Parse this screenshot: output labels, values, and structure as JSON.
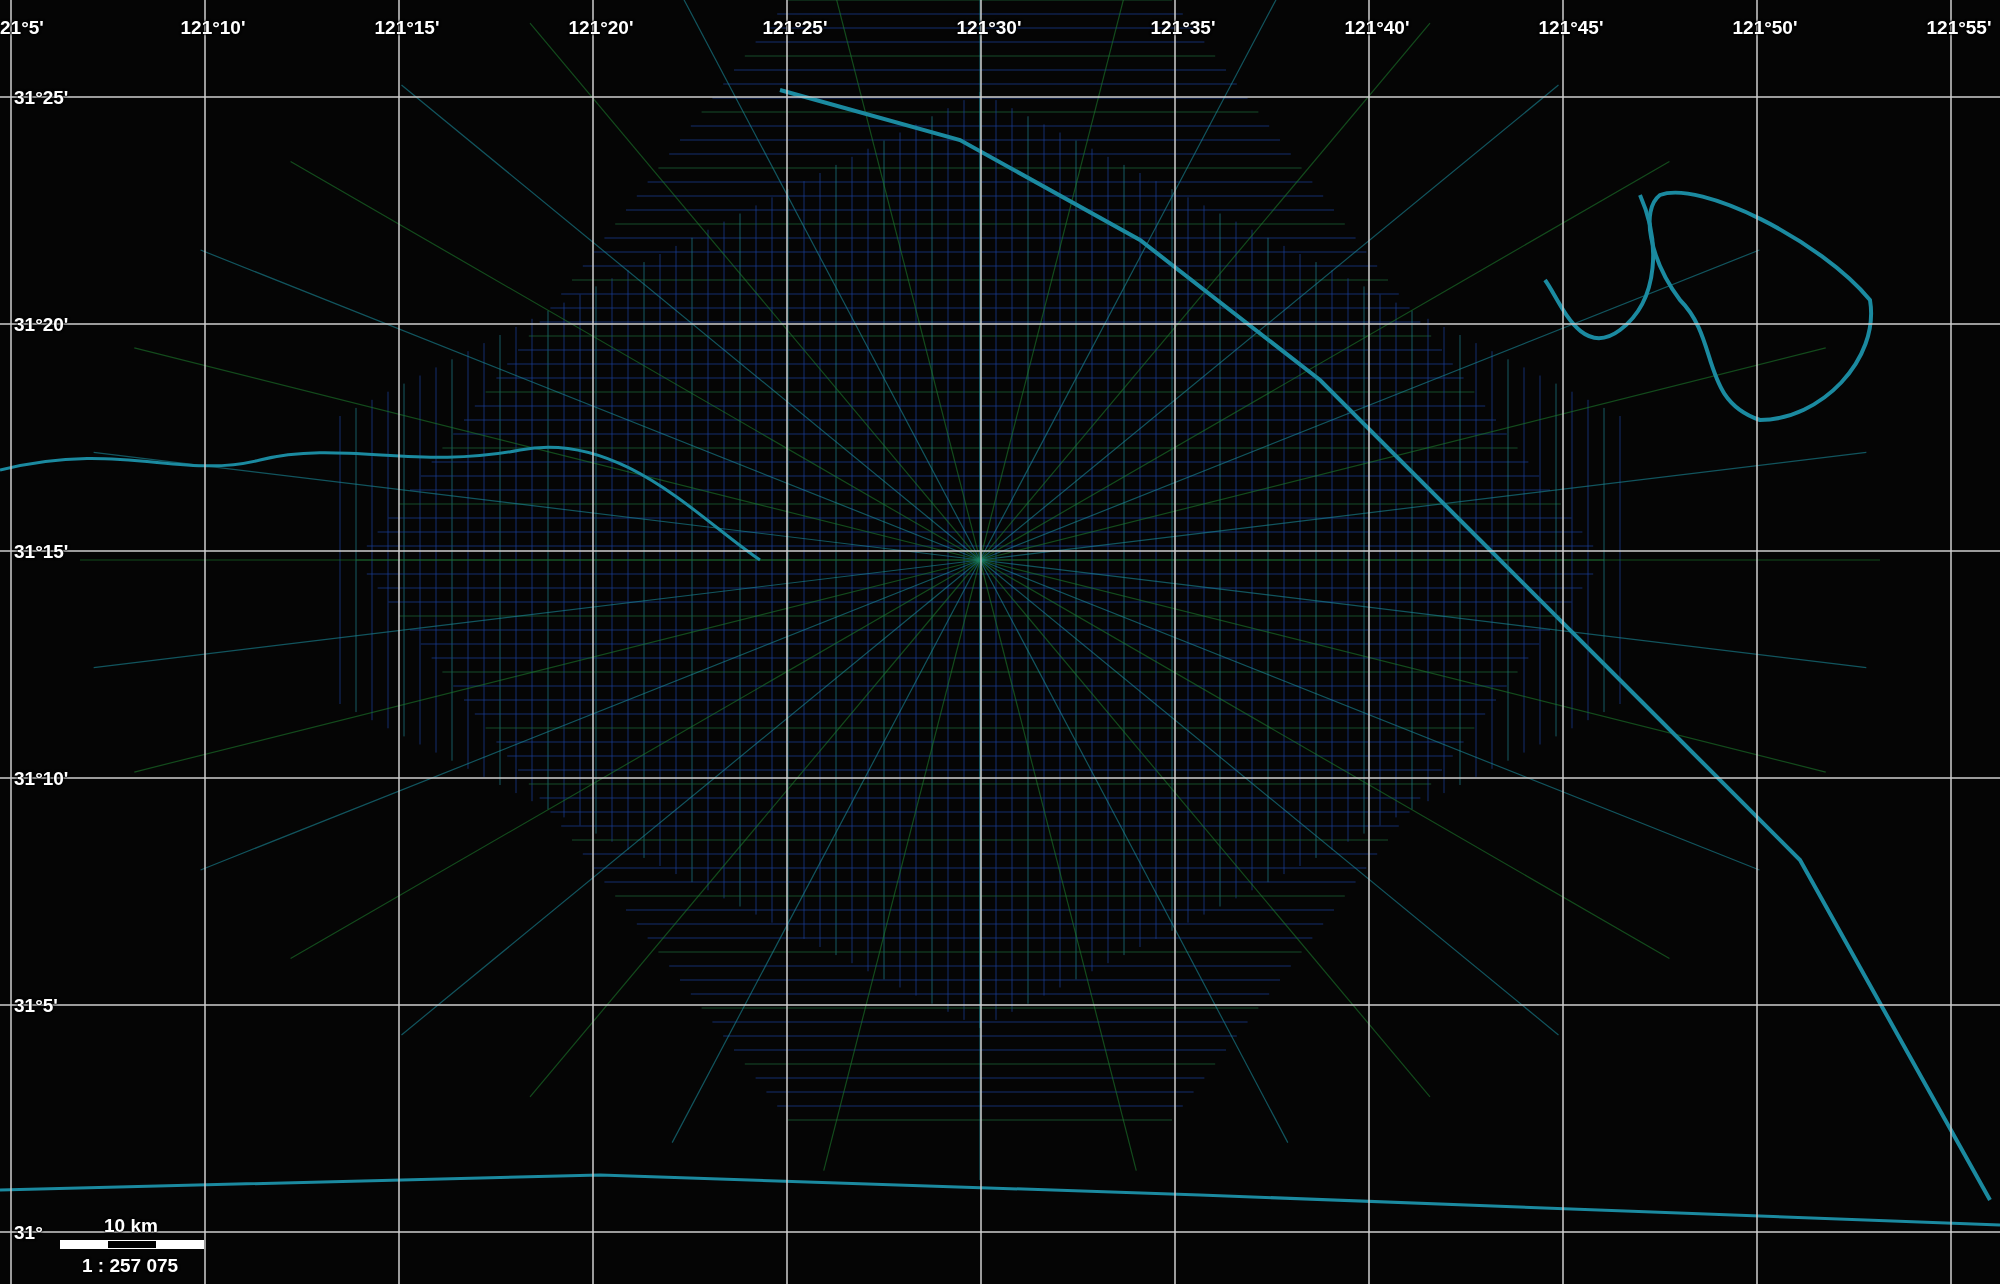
{
  "graticule": {
    "longitude_labels": [
      "21°5'",
      "121°10'",
      "121°15'",
      "121°20'",
      "121°25'",
      "121°30'",
      "121°35'",
      "121°40'",
      "121°45'",
      "121°50'",
      "121°55'"
    ],
    "latitude_labels": [
      "31°25'",
      "31°20'",
      "31°15'",
      "31°10'",
      "31°5'",
      "31°"
    ]
  },
  "scale_bar": {
    "distance": "10 km",
    "ratio": "1 : 257 075"
  }
}
